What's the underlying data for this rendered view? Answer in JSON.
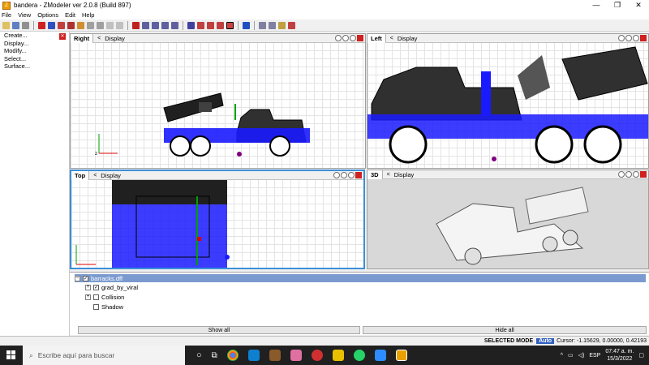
{
  "window": {
    "title": "bandera - ZModeler ver 2.0.8 (Build 897)",
    "app_icon_label": "Z"
  },
  "menu": [
    "File",
    "View",
    "Options",
    "Edit",
    "Help"
  ],
  "commands": [
    "Create...",
    "Display...",
    "Modify...",
    "Select...",
    "Surface..."
  ],
  "viewports": {
    "right": {
      "name": "Right",
      "display": "Display"
    },
    "left": {
      "name": "Left",
      "display": "Display"
    },
    "top": {
      "name": "Top",
      "display": "Display"
    },
    "persp": {
      "name": "3D",
      "display": "Display"
    }
  },
  "tree": {
    "root": "barracks.dff",
    "children": [
      {
        "label": "grad_by_viral",
        "checked": true
      },
      {
        "label": "Collision",
        "checked": false
      },
      {
        "label": "Shadow",
        "checked": false
      }
    ]
  },
  "buttons": {
    "show_all": "Show all",
    "hide_all": "Hide all"
  },
  "status": {
    "mode": "SELECTED MODE",
    "auto": "Auto",
    "cursor": "Cursor: -1.15629, 0.00000, 0.42193"
  },
  "taskbar": {
    "search_placeholder": "Escribe aquí para buscar",
    "language": "ESP",
    "time": "07:47 a. m.",
    "date": "15/3/2022"
  },
  "colors": {
    "accent": "#3c8fd8",
    "mesh_blue": "#1a1aff",
    "close_red": "#d02020"
  }
}
